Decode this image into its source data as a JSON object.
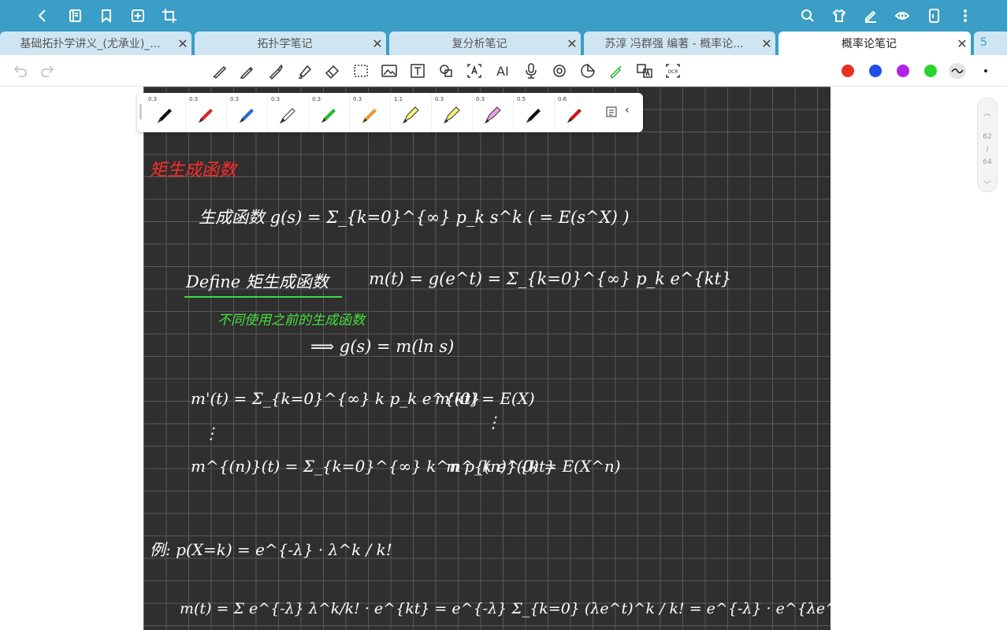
{
  "topbar": {
    "left_icons": [
      "back-icon",
      "book-icon",
      "bookmark-icon",
      "add-page-icon",
      "crop-icon"
    ],
    "right_icons": [
      "search-icon",
      "shirt-icon",
      "pen-edit-icon",
      "eye-icon",
      "phone-icon",
      "more-vertical-icon"
    ]
  },
  "tabs": [
    {
      "label": "基础拓扑学讲义_(尤承业)_...",
      "close": "✕"
    },
    {
      "label": "拓扑学笔记",
      "close": "✕"
    },
    {
      "label": "复分析笔记",
      "close": "✕"
    },
    {
      "label": "苏淳 冯群强 编著 - 概率论...",
      "close": "✕"
    },
    {
      "label": "概率论笔记",
      "close": "✕"
    }
  ],
  "tab_count": "5",
  "toolbar": {
    "ai_label": "AI",
    "colors": [
      "#e8311f",
      "#1f4fe8",
      "#b222e8",
      "#27d42b"
    ]
  },
  "pens": [
    {
      "size": "0.3",
      "color": "#111111"
    },
    {
      "size": "0.3",
      "color": "#d42a2a"
    },
    {
      "size": "0.3",
      "color": "#2a6ad4"
    },
    {
      "size": "0.3",
      "color": "#ffffff"
    },
    {
      "size": "0.3",
      "color": "#2ab82a"
    },
    {
      "size": "0.3",
      "color": "#e89a2a"
    },
    {
      "size": "1.1",
      "color": "#f5f07a"
    },
    {
      "size": "0.3",
      "color": "#f5f07a"
    },
    {
      "size": "0.3",
      "color": "#f0a0e0"
    },
    {
      "size": "0.5",
      "color": "#111111"
    },
    {
      "size": "0.6",
      "color": "#c21a1a"
    }
  ],
  "pager": {
    "current": "62",
    "sep": "/",
    "total": "64"
  },
  "notes": {
    "heading": "矩生成函数",
    "line1": "生成函数   g(s) = Σ_{k=0}^{∞} p_k s^k  ( = E(s^X) )",
    "line2_label": "Define  矩生成函数",
    "line2_formula": "m(t) = g(e^t) = Σ_{k=0}^{∞} p_k e^{kt}",
    "line3": "不同使用之前的生成函数",
    "line4": "⟹  g(s) = m(ln s)",
    "line5a": "m'(t) = Σ_{k=0}^{∞} k p_k e^{kt}",
    "line5b": "m'(0) = E(X)",
    "dots": "⋮",
    "line6a": "m^{(n)}(t) = Σ_{k=0}^{∞} k^n p_k e^{kt}",
    "line6b": "m^{(n)}(0) = E(X^n)",
    "line7": "例:   p(X=k) = e^{-λ} · λ^k / k!",
    "line8": "m(t) = Σ e^{-λ} λ^k/k! · e^{kt} = e^{-λ} Σ_{k=0} (λe^t)^k / k! = e^{-λ} · e^{λe^t}"
  }
}
